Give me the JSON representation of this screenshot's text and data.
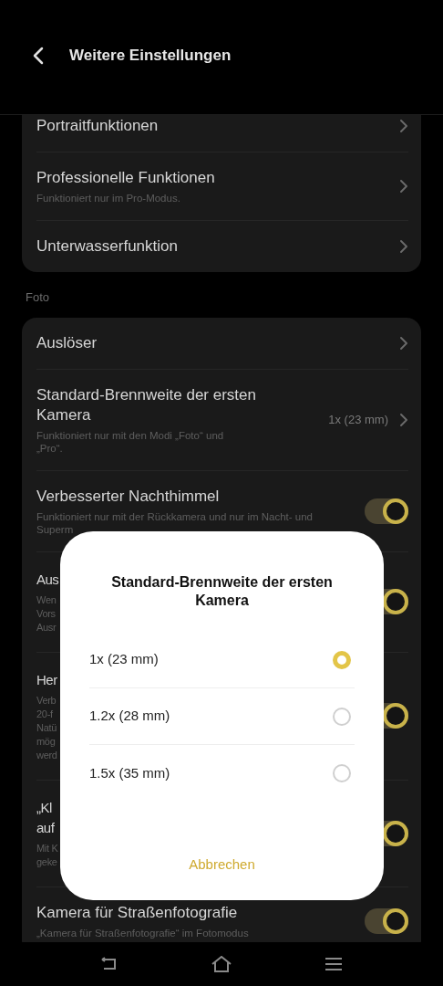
{
  "header": {
    "title": "Weitere Einstellungen"
  },
  "sections": [
    {
      "rows": [
        {
          "kind": "chevron",
          "title": "Portraitfunktionen",
          "lines": []
        },
        {
          "kind": "chevron",
          "title": "Professionelle Funktionen",
          "lines": [
            "Funktioniert nur im Pro-Modus."
          ]
        },
        {
          "kind": "chevron",
          "title": "Unterwasserfunktion",
          "lines": []
        }
      ]
    },
    {
      "label": "Foto",
      "rows": [
        {
          "kind": "chevron",
          "title": "Auslöser",
          "lines": []
        },
        {
          "kind": "value",
          "title": "Standard-Brennweite der ersten Kamera",
          "value": "1x (23 mm)",
          "lines": [
            "Funktioniert nur mit den Modi „Foto“ und",
            "„Pro“."
          ]
        },
        {
          "kind": "toggle",
          "title": "Verbesserter Nachthimmel",
          "on": true,
          "lines": [
            "Funktioniert nur mit der Rückkamera und nur im Nacht- und",
            "Superm"
          ]
        },
        {
          "kind": "toggle",
          "title": "Aus",
          "on": true,
          "lines": [
            "Wen",
            "Vors",
            "Ausr"
          ]
        },
        {
          "kind": "toggle",
          "title": "Her",
          "on": true,
          "lines": [
            "Verb",
            "20-f",
            "Natü",
            "mög",
            "werd"
          ]
        },
        {
          "kind": "toggle",
          "title": "„Kl auf",
          "on": true,
          "lines": [
            "Mit K",
            "geke"
          ]
        },
        {
          "kind": "toggle",
          "title": "Kamera für Straßenfotografie",
          "on": true,
          "lines": [
            "„Kamera für Straßenfotografie“ im Fotomodus"
          ]
        }
      ]
    }
  ],
  "dialog": {
    "title": "Standard-Brennweite der ersten Kamera",
    "options": [
      {
        "label": "1x (23 mm)",
        "selected": true
      },
      {
        "label": "1.2x (28 mm)",
        "selected": false
      },
      {
        "label": "1.5x (35 mm)",
        "selected": false
      }
    ],
    "cancel": "Abbrechen"
  }
}
